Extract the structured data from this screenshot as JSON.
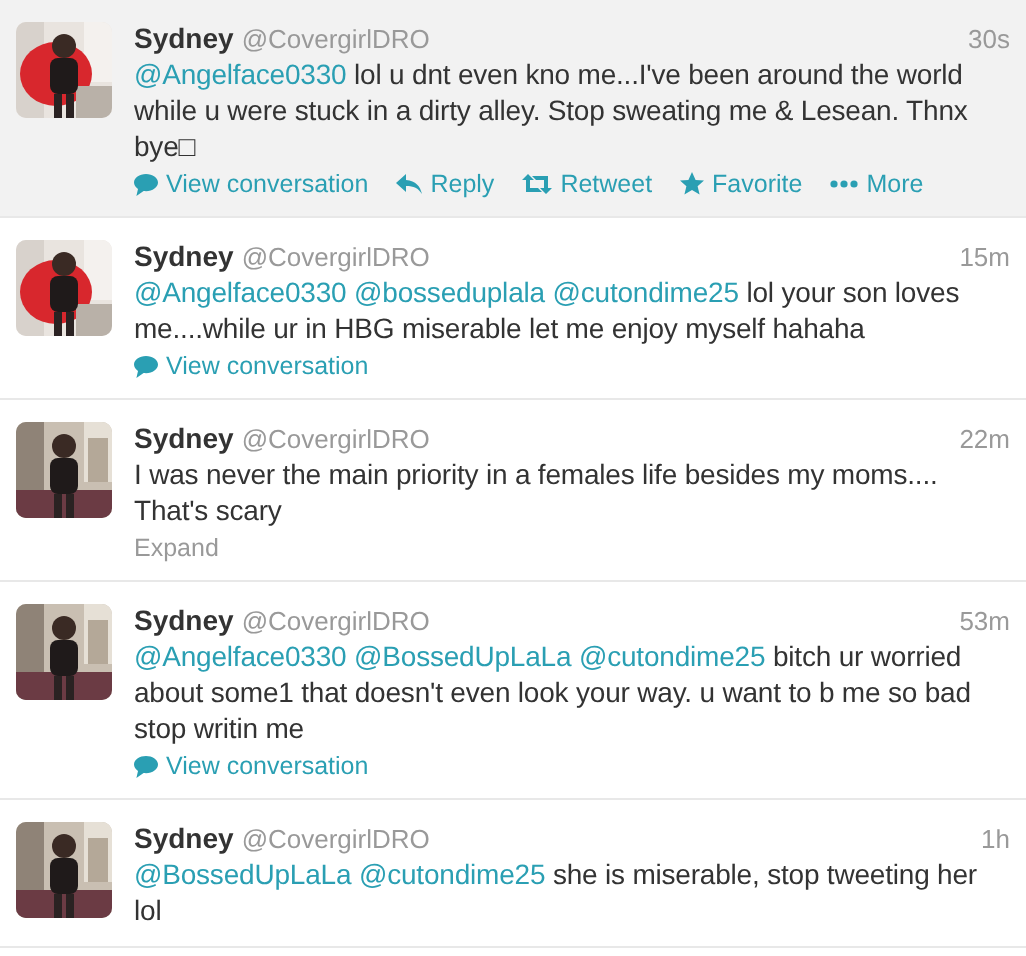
{
  "tweets": [
    {
      "avatar": {
        "kind": "picture"
      },
      "name": "Sydney",
      "handle": "@CovergirlDRO",
      "time": "30s",
      "hovered": true,
      "text": [
        {
          "kind": "mention",
          "text": "@Angelface0330"
        },
        {
          "kind": "text",
          "text": "lol u dnt even kno me...I've been around the world while u were stuck in a dirty alley. Stop sweating me & Lesean. Thnx bye□"
        }
      ],
      "link": {
        "kind": "conversation",
        "label": "View conversation"
      },
      "actions": [
        {
          "kind": "reply",
          "label": "Reply"
        },
        {
          "kind": "retweet",
          "label": "Retweet"
        },
        {
          "kind": "favorite",
          "label": "Favorite"
        },
        {
          "kind": "more",
          "label": "More"
        }
      ]
    },
    {
      "avatar": {
        "kind": "picture"
      },
      "name": "Sydney",
      "handle": "@CovergirlDRO",
      "time": "15m",
      "hovered": false,
      "text": [
        {
          "kind": "mention",
          "text": "@Angelface0330"
        },
        {
          "kind": "mention",
          "text": "@bosseduplala"
        },
        {
          "kind": "mention",
          "text": "@cutondime25"
        },
        {
          "kind": "text",
          "text": "lol your son loves me....while ur in HBG miserable let me enjoy myself hahaha"
        }
      ],
      "link": {
        "kind": "conversation",
        "label": "View conversation"
      }
    },
    {
      "avatar": {
        "kind": "picture"
      },
      "name": "Sydney",
      "handle": "@CovergirlDRO",
      "time": "22m",
      "hovered": false,
      "text": [
        {
          "kind": "text",
          "text": "I was never the main priority in a females life besides my moms.... That's scary"
        }
      ],
      "link": {
        "kind": "expand",
        "label": "Expand"
      }
    },
    {
      "avatar": {
        "kind": "picture"
      },
      "name": "Sydney",
      "handle": "@CovergirlDRO",
      "time": "53m",
      "hovered": false,
      "text": [
        {
          "kind": "mention",
          "text": "@Angelface0330"
        },
        {
          "kind": "mention",
          "text": "@BossedUpLaLa"
        },
        {
          "kind": "mention",
          "text": "@cutondime25"
        },
        {
          "kind": "text",
          "text": "bitch ur worried about some1 that doesn't even look your way. u want to b me so bad stop writin me"
        }
      ],
      "link": {
        "kind": "conversation",
        "label": "View conversation"
      }
    },
    {
      "avatar": {
        "kind": "picture"
      },
      "name": "Sydney",
      "handle": "@CovergirlDRO",
      "time": "1h",
      "hovered": false,
      "text": [
        {
          "kind": "mention",
          "text": "@BossedUpLaLa"
        },
        {
          "kind": "mention",
          "text": "@cutondime25"
        },
        {
          "kind": "text",
          "text": "she is miserable, stop tweeting her lol"
        }
      ]
    }
  ]
}
